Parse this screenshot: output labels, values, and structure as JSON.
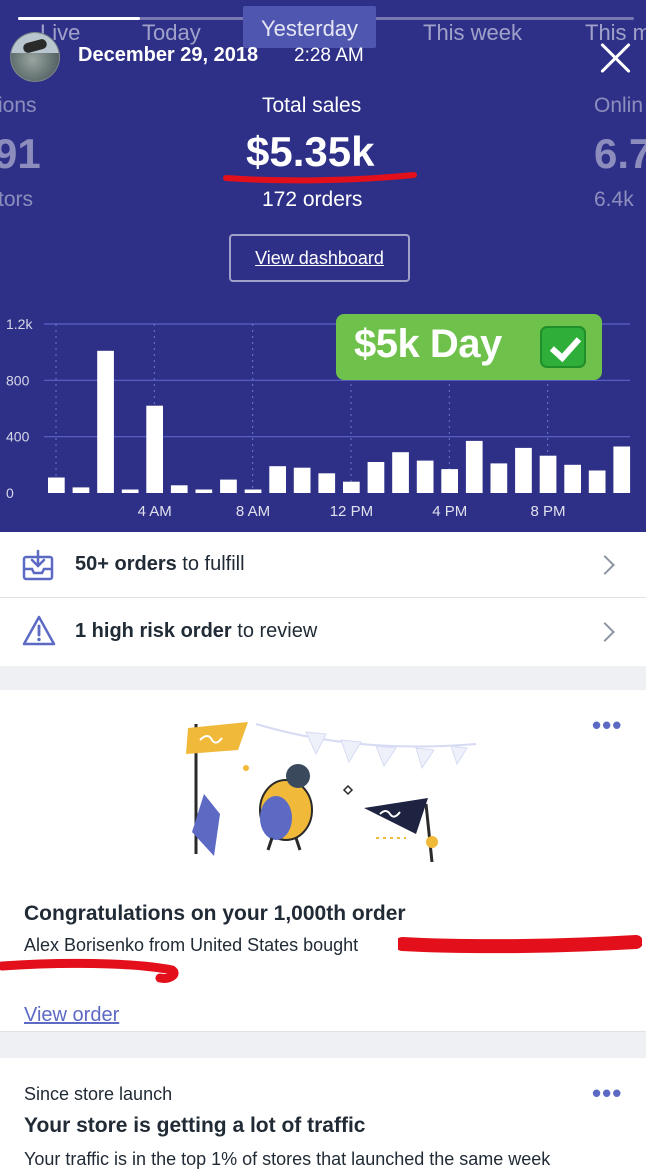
{
  "header": {
    "tabs": [
      {
        "label": "Live"
      },
      {
        "label": "Today"
      },
      {
        "label": "Yesterday",
        "active": true
      },
      {
        "label": "This week"
      },
      {
        "label": "This m"
      }
    ],
    "date": "December 29, 2018",
    "time": "2:28 AM",
    "left_metric": {
      "label": "ions",
      "value": "91",
      "sub": "tors"
    },
    "total_sales": {
      "label": "Total sales",
      "value": "$5.35k",
      "orders": "172 orders"
    },
    "right_metric": {
      "label": "Onlin",
      "value": "6.7",
      "sub": "6.4k"
    },
    "view_dashboard": "View dashboard",
    "sticker_text": "$5k Day",
    "colors": {
      "header_bg": "#2e3088",
      "sticker_bg": "#6ec14a",
      "accent": "#5c6ac4",
      "annotation_red": "#e3101b"
    }
  },
  "chart_data": {
    "type": "bar",
    "y_ticks": [
      "0",
      "400",
      "800",
      "1.2k"
    ],
    "ylim": [
      0,
      1200
    ],
    "x_tick_labels": [
      "4 AM",
      "8 AM",
      "12 PM",
      "4 PM",
      "8 PM"
    ],
    "values": [
      110,
      40,
      1010,
      25,
      620,
      55,
      25,
      95,
      25,
      190,
      180,
      140,
      80,
      220,
      290,
      230,
      170,
      370,
      210,
      320,
      265,
      200,
      160,
      330
    ],
    "grid": true
  },
  "tasks": [
    {
      "bold": "50+ orders",
      "rest": " to fulfill",
      "icon": "inbox-download-icon"
    },
    {
      "bold": "1 high risk order",
      "rest": " to review",
      "icon": "warning-triangle-icon"
    }
  ],
  "card1": {
    "more": "•••",
    "title": "Congratulations on your 1,000th order",
    "body": "Alex Borisenko from United States bought",
    "link": "View order"
  },
  "card2": {
    "more": "•••",
    "label": "Since store launch",
    "title": "Your store is getting a lot of traffic",
    "body": "Your traffic is in the top 1% of stores that launched the same week"
  }
}
